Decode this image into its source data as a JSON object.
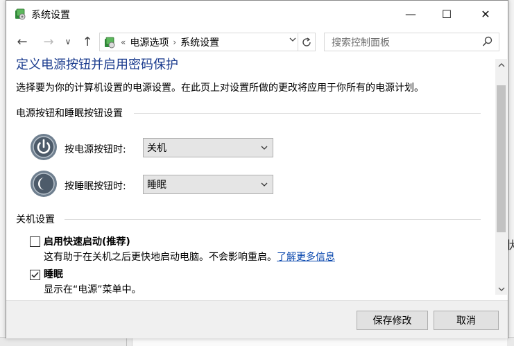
{
  "window": {
    "title": "系统设置",
    "controls": {
      "minimize": "—",
      "maximize": "☐",
      "close": "✕"
    }
  },
  "nav": {
    "back": "←",
    "forward": "→",
    "recent": "∨",
    "up": "↑"
  },
  "address": {
    "overflow": "«",
    "crumbs": [
      "电源选项",
      "系统设置"
    ],
    "separator": "›"
  },
  "search": {
    "placeholder": "搜索控制面板"
  },
  "page": {
    "heading": "定义电源按钮并启用密码保护",
    "description": "选择要为你的计算机设置的电源设置。在此页上对设置所做的更改将应用于你所有的电源计划。"
  },
  "power_section": {
    "title": "电源按钮和睡眠按钮设置",
    "power_button": {
      "label": "按电源按钮时:",
      "value": "关机"
    },
    "sleep_button": {
      "label": "按睡眠按钮时:",
      "value": "睡眠"
    }
  },
  "shutdown_section": {
    "title": "关机设置",
    "fast_startup": {
      "label": "启用快速启动(推荐)",
      "checked": false,
      "description": "这有助于在关机之后更快地启动电脑。不会影响重启。",
      "link": "了解更多信息"
    },
    "sleep": {
      "label": "睡眠",
      "checked": true,
      "description": "显示在“电源”菜单中。"
    }
  },
  "footer": {
    "save": "保存修改",
    "cancel": "取消"
  },
  "background": {
    "edge_text": "状"
  },
  "colors": {
    "heading": "#1a3b8e",
    "link": "#0645ad"
  }
}
